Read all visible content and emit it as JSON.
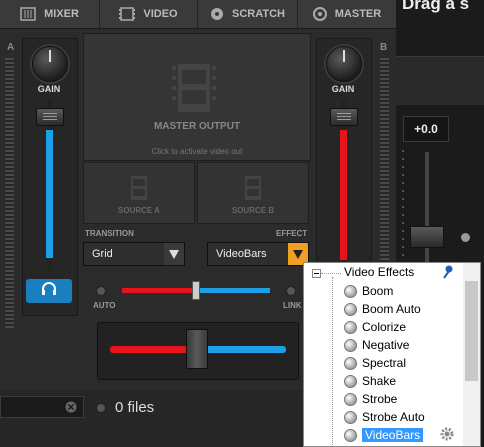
{
  "tabs": [
    {
      "label": "MIXER",
      "icon": "mixer-icon"
    },
    {
      "label": "VIDEO",
      "icon": "film-icon"
    },
    {
      "label": "SCRATCH",
      "icon": "vinyl-icon"
    },
    {
      "label": "MASTER",
      "icon": "target-icon"
    }
  ],
  "overlay_title": "Drag a s",
  "deck_a": {
    "letter": "A",
    "gain_label": "GAIN"
  },
  "deck_b": {
    "letter": "B",
    "gain_label": "GAIN"
  },
  "master_output": {
    "title": "MASTER OUTPUT",
    "hint": "Click to activate video out"
  },
  "sources": {
    "a": "SOURCE A",
    "b": "SOURCE B"
  },
  "transition": {
    "label": "TRANSITION",
    "value": "Grid"
  },
  "effect": {
    "label": "EFFECT",
    "value": "VideoBars"
  },
  "crossfader": {
    "auto_label": "AUTO",
    "link_label": "LINK"
  },
  "pitch": {
    "value": "+0.0"
  },
  "browser": {
    "files_label": "0 files"
  },
  "popup": {
    "root": "Video Effects",
    "items": [
      "Boom",
      "Boom Auto",
      "Colorize",
      "Negative",
      "Spectral",
      "Shake",
      "Strobe",
      "Strobe Auto",
      "VideoBars"
    ],
    "selected": "VideoBars"
  },
  "colors": {
    "accent_blue": "#1ea0e6",
    "accent_red": "#e8141c",
    "orange": "#f0a020",
    "selection": "#3399ff"
  }
}
